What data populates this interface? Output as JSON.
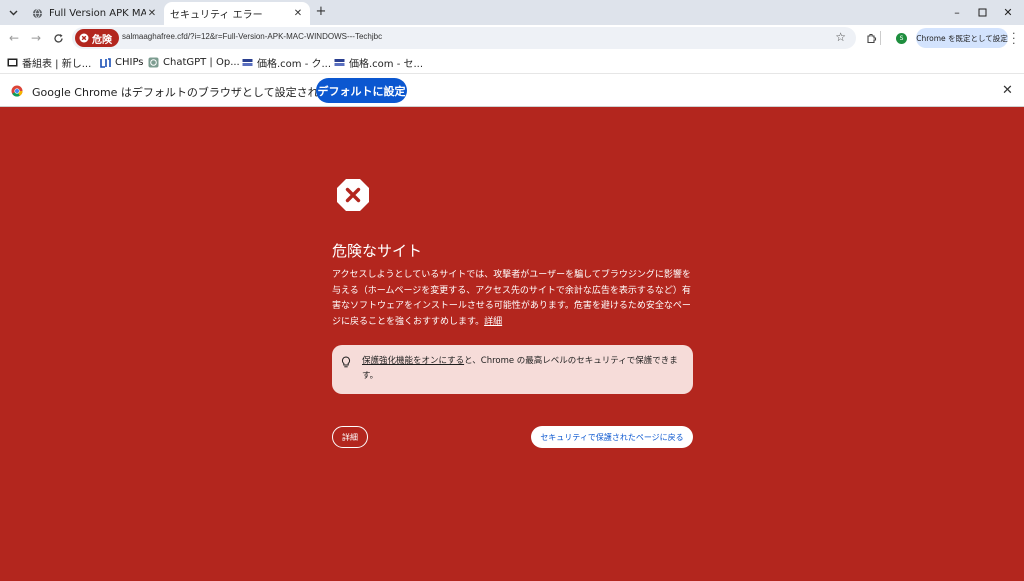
{
  "tabs": [
    {
      "title": "Full Version APK MAC",
      "active": false
    },
    {
      "title": "セキュリティ エラー",
      "active": true
    }
  ],
  "toolbar": {
    "danger_label": "危険",
    "url": "salmaaghafree.cfd/?i=12&r=Full-Version-APK-MAC-WINDOWS---Techjbc",
    "profile_initial": "S",
    "set_default_pill": "Chrome を既定として設定"
  },
  "bookmarks": [
    {
      "label": "番組表 | 新し...",
      "icon": "tv-icon"
    },
    {
      "label": "CHIPs",
      "icon": "chips-icon"
    },
    {
      "label": "ChatGPT | Op...",
      "icon": "chatgpt-icon"
    },
    {
      "label": "価格.com - ク...",
      "icon": "kakaku-icon"
    },
    {
      "label": "価格.com - セ...",
      "icon": "kakaku-icon"
    }
  ],
  "infobar": {
    "message": "Google Chrome はデフォルトのブラウザとして設定されていません",
    "button": "デフォルトに設定"
  },
  "interstitial": {
    "heading": "危険なサイト",
    "body": "アクセスしようとしているサイトでは、攻撃者がユーザーを騙してブラウジングに影響を与える（ホームページを変更する、アクセス先のサイトで余計な広告を表示するなど）有害なソフトウェアをインストールさせる可能性があります。危害を避けるため安全なページに戻ることを強くおすすめします。",
    "more_link": "詳細",
    "tip_link": "保護強化機能をオンにする",
    "tip_rest": "と、Chrome の最高レベルのセキュリティで保護できます。",
    "details_button": "詳細",
    "back_button": "セキュリティで保護されたページに戻る"
  },
  "colors": {
    "danger_red": "#b3261e",
    "accent_blue": "#0b57d0",
    "tip_bg": "#f6dcd9"
  }
}
